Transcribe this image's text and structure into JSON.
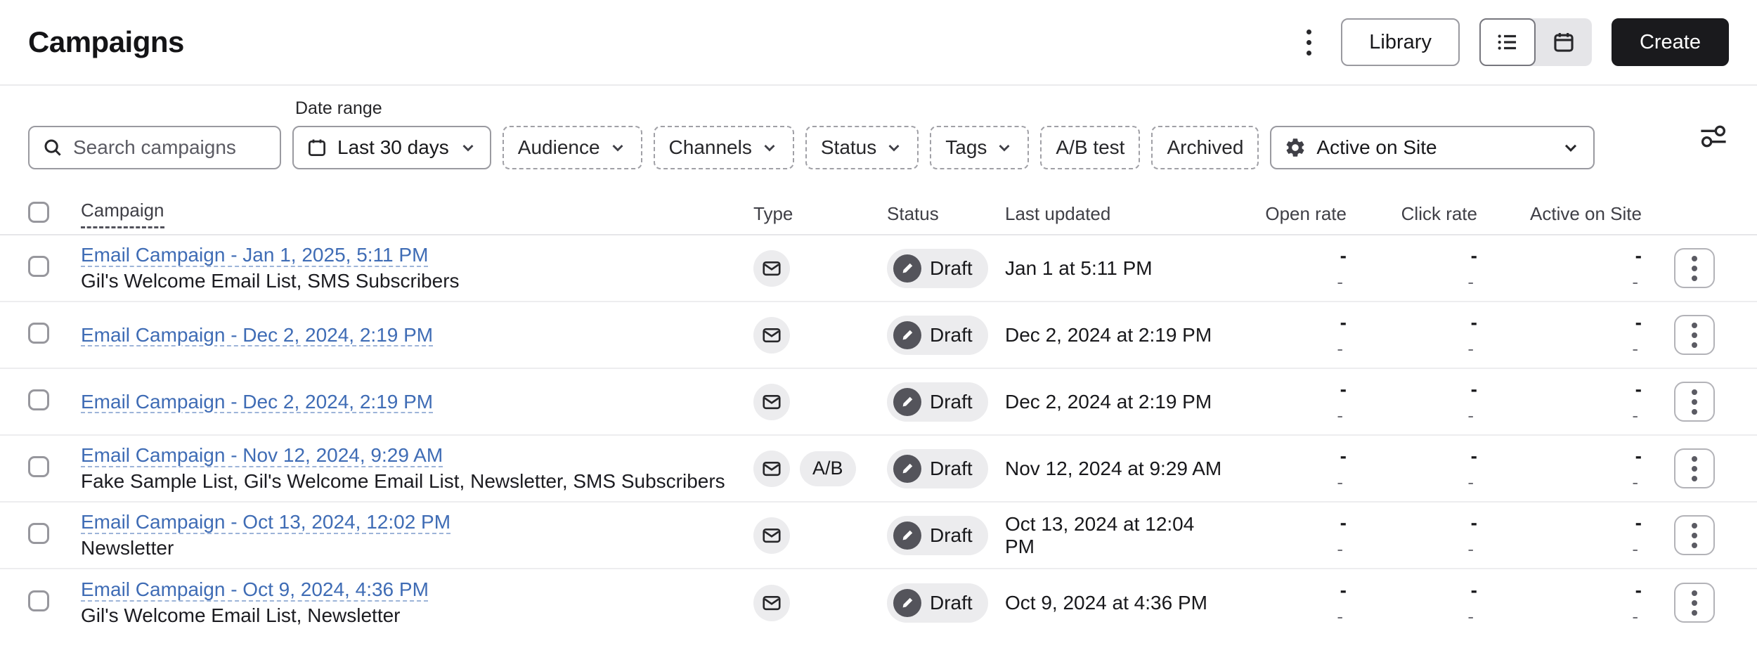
{
  "header": {
    "title": "Campaigns",
    "library_button": "Library",
    "create_button": "Create",
    "view_toggle_selected": "list"
  },
  "filters": {
    "search": {
      "placeholder": "Search campaigns",
      "value": ""
    },
    "date_range": {
      "label": "Date range",
      "value": "Last 30 days"
    },
    "audience": "Audience",
    "channels": "Channels",
    "status": "Status",
    "tags": "Tags",
    "ab_test": "A/B test",
    "archived": "Archived",
    "metric_selector": {
      "value": "Active on Site"
    }
  },
  "table": {
    "headers": {
      "campaign": "Campaign",
      "type": "Type",
      "status": "Status",
      "last_updated": "Last updated",
      "open_rate": "Open rate",
      "click_rate": "Click rate",
      "active_on_site": "Active on Site"
    },
    "rows": [
      {
        "title": "Email Campaign - Jan 1, 2025, 5:11 PM",
        "subtitle": "Gil's Welcome Email List, SMS Subscribers",
        "type_icon": "email-icon",
        "status": "Draft",
        "last_updated": "Jan 1 at 5:11 PM",
        "open_rate": "-",
        "open_rate_secondary": "-",
        "click_rate": "-",
        "click_rate_secondary": "-",
        "active_on_site": "-",
        "active_on_site_secondary": "-"
      },
      {
        "title": "Email Campaign - Dec 2, 2024, 2:19 PM",
        "type_icon": "email-icon",
        "status": "Draft",
        "last_updated": "Dec 2, 2024 at 2:19 PM",
        "open_rate": "-",
        "open_rate_secondary": "-",
        "click_rate": "-",
        "click_rate_secondary": "-",
        "active_on_site": "-",
        "active_on_site_secondary": "-"
      },
      {
        "title": "Email Campaign - Dec 2, 2024, 2:19 PM",
        "type_icon": "email-icon",
        "status": "Draft",
        "last_updated": "Dec 2, 2024 at 2:19 PM",
        "open_rate": "-",
        "open_rate_secondary": "-",
        "click_rate": "-",
        "click_rate_secondary": "-",
        "active_on_site": "-",
        "active_on_site_secondary": "-"
      },
      {
        "title": "Email Campaign - Nov 12, 2024, 9:29 AM",
        "subtitle": "Fake Sample List, Gil's Welcome Email List, Newsletter, SMS Subscribers",
        "type_icon": "email-icon",
        "type_badge": "A/B",
        "status": "Draft",
        "last_updated": "Nov 12, 2024 at 9:29 AM",
        "open_rate": "-",
        "open_rate_secondary": "-",
        "click_rate": "-",
        "click_rate_secondary": "-",
        "active_on_site": "-",
        "active_on_site_secondary": "-"
      },
      {
        "title": "Email Campaign - Oct 13, 2024, 12:02 PM",
        "subtitle": "Newsletter",
        "type_icon": "email-icon",
        "status": "Draft",
        "last_updated": "Oct 13, 2024 at 12:04 PM",
        "open_rate": "-",
        "open_rate_secondary": "-",
        "click_rate": "-",
        "click_rate_secondary": "-",
        "active_on_site": "-",
        "active_on_site_secondary": "-"
      },
      {
        "title": "Email Campaign - Oct 9, 2024, 4:36 PM",
        "subtitle": "Gil's Welcome Email List, Newsletter",
        "type_icon": "email-icon",
        "status": "Draft",
        "last_updated": "Oct 9, 2024 at 4:36 PM",
        "open_rate": "-",
        "open_rate_secondary": "-",
        "click_rate": "-",
        "click_rate_secondary": "-",
        "active_on_site": "-",
        "active_on_site_secondary": "-"
      }
    ]
  },
  "colors": {
    "link_blue": "#3f6cb5",
    "create_button_bg": "#1a1a1d",
    "badge_bg": "#ececee",
    "draft_icon_bg": "#54545b",
    "row_divider": "#ededef"
  }
}
